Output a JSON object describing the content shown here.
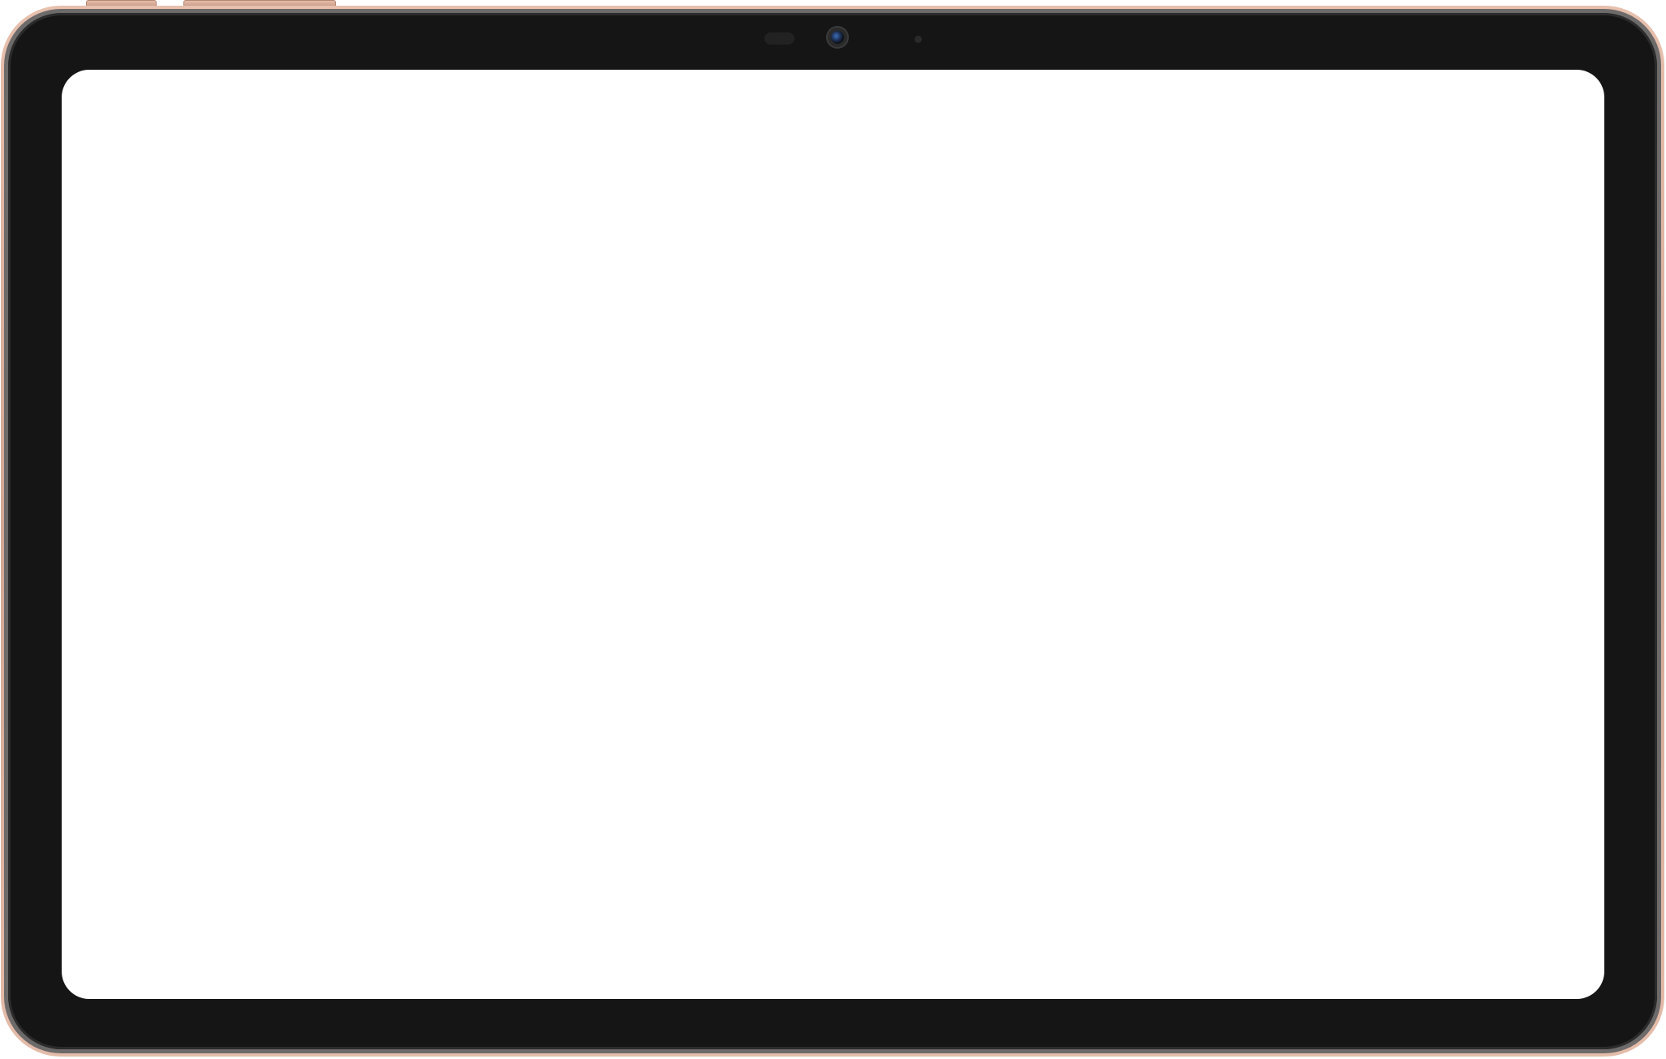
{
  "device": {
    "type": "tablet",
    "orientation": "landscape",
    "colors": {
      "frame": "#d2a795",
      "bezel": "#151515",
      "screen": "#ffffff"
    },
    "icons": [
      "front-camera-icon"
    ]
  }
}
